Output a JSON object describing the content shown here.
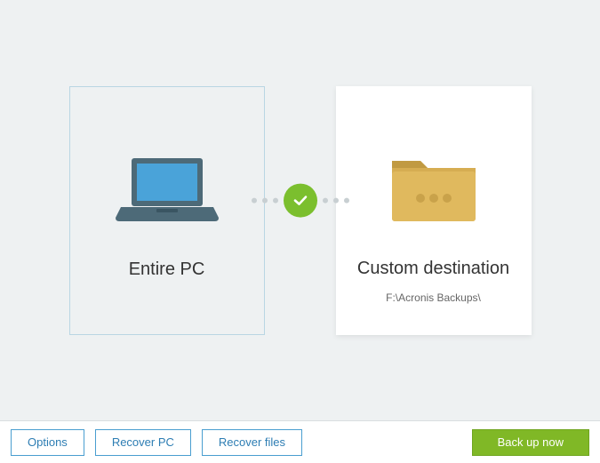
{
  "source": {
    "title": "Entire PC"
  },
  "destination": {
    "title": "Custom destination",
    "path": "F:\\Acronis Backups\\"
  },
  "footer": {
    "options": "Options",
    "recover_pc": "Recover PC",
    "recover_files": "Recover files",
    "backup_now": "Back up now"
  }
}
